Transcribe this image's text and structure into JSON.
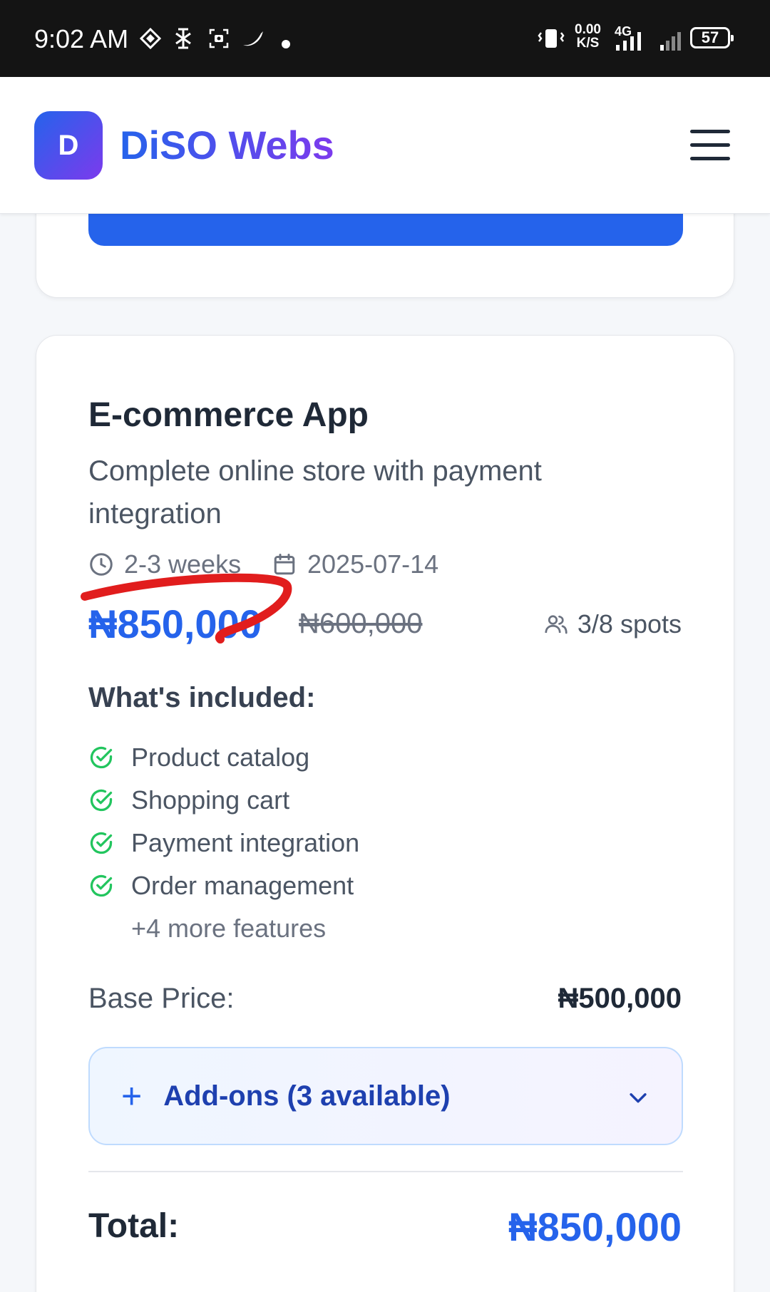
{
  "status_bar": {
    "time": "9:02 AM",
    "net_speed_value": "0.00",
    "net_speed_unit": "K/S",
    "network_type": "4G",
    "battery": "57",
    "icons": [
      "navigation-icon",
      "bug-icon",
      "screenshot-icon",
      "pepper-icon",
      "dot-icon",
      "vibrate-icon",
      "signal-icon",
      "signal-weak-icon",
      "battery-icon"
    ]
  },
  "header": {
    "logo_letter": "D",
    "brand": "DiSO Webs",
    "menu_icon": "hamburger-icon"
  },
  "card": {
    "title": "E-commerce App",
    "description": "Complete online store with payment integration",
    "duration": "2-3 weeks",
    "date": "2025-07-14",
    "price": "₦850,000",
    "old_price": "₦600,000",
    "spots": "3/8 spots",
    "included_title": "What's included:",
    "features": [
      "Product catalog",
      "Shopping cart",
      "Payment integration",
      "Order management"
    ],
    "more_features": "+4 more features",
    "base_price_label": "Base Price:",
    "base_price_value": "₦500,000",
    "addons_label": "Add-ons (3 available)",
    "total_label": "Total:",
    "total_value": "₦850,000"
  },
  "colors": {
    "accent": "#2563eb",
    "brand_gradient_end": "#7c3aed",
    "check": "#22c55e",
    "annotation": "#e11d1d"
  }
}
